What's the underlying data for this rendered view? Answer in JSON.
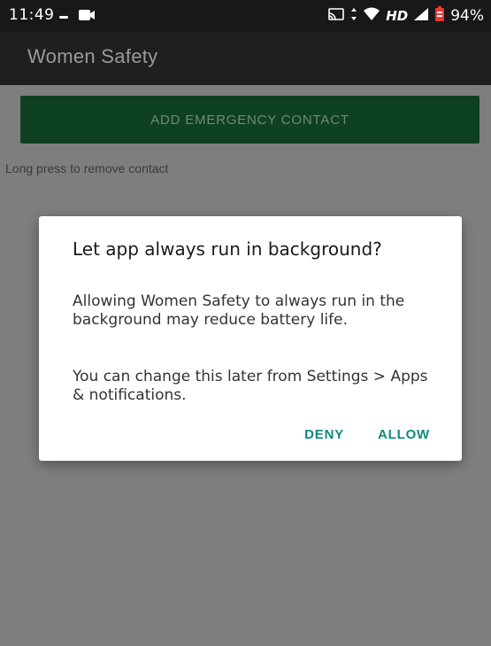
{
  "status_bar": {
    "time": "11:49",
    "network_label": "HD",
    "battery_percent": "94%"
  },
  "app_bar": {
    "title": "Women Safety"
  },
  "main": {
    "add_contact_label": "ADD EMERGENCY CONTACT",
    "hint": "Long press to remove contact"
  },
  "dialog": {
    "title": "Let app always run in background?",
    "message_1": "Allowing Women Safety to always run in the background may reduce battery life.",
    "message_2": "You can change this later from Settings > Apps & notifications.",
    "deny_label": "DENY",
    "allow_label": "ALLOW"
  },
  "colors": {
    "accent": "#0e8a7a",
    "button_green": "#0e4120",
    "scrim": "#7e7e7e",
    "app_bar": "#1f1f1f"
  },
  "icons": [
    "notification-dot-icon",
    "screen-record-icon",
    "cast-icon",
    "data-transfer-icon",
    "wifi-icon",
    "signal-icon",
    "battery-icon"
  ]
}
